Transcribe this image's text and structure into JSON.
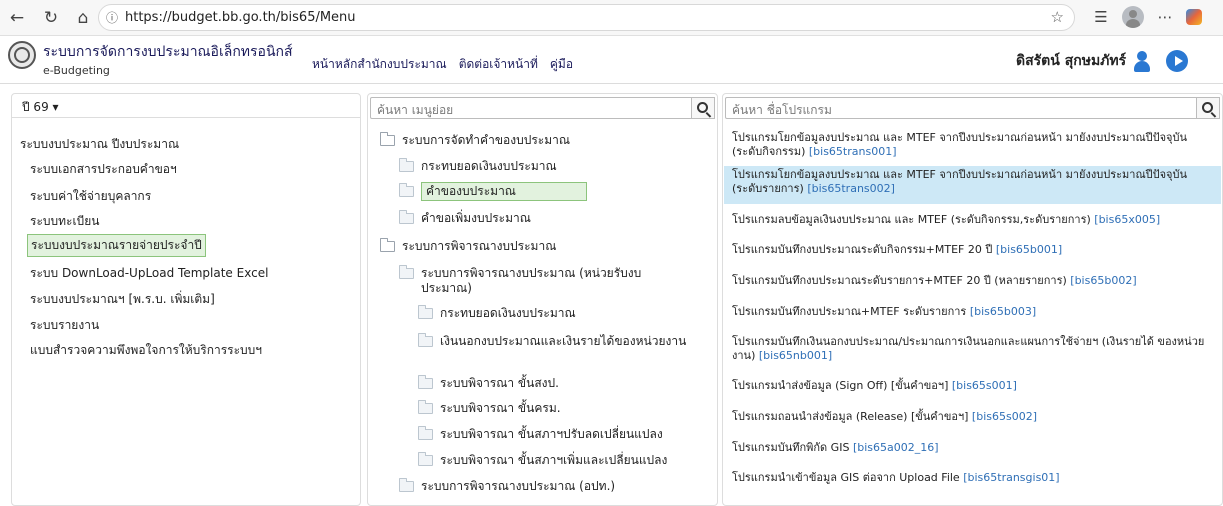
{
  "browser": {
    "url": "https://budget.bb.go.th/bis65/Menu"
  },
  "header": {
    "system_title": "ระบบการจัดการงบประมาณอิเล็กทรอนิกส์",
    "system_subtitle": "e-Budgeting",
    "nav": [
      "หน้าหลักสำนักงบประมาณ",
      "ติดต่อเจ้าหน้าที่",
      "คู่มือ"
    ],
    "user_name": "ดิสรัตน์ สุกษมภัทร์"
  },
  "left_panel": {
    "year_label": "ปี 69 ▾",
    "items": [
      "ระบบงบประมาณ ปีงบประมาณ",
      "ระบบเอกสารประกอบคำขอฯ",
      "ระบบค่าใช้จ่ายบุคลากร",
      "ระบบทะเบียน",
      "ระบบงบประมาณรายจ่ายประจำปี",
      "ระบบ DownLoad-UpLoad Template Excel",
      "ระบบงบประมาณฯ [พ.ร.บ. เพิ่มเติม]",
      "ระบบรายงาน",
      "แบบสำรวจความพึงพอใจการให้บริการระบบฯ"
    ],
    "selected_index": 4
  },
  "middle_panel": {
    "search_placeholder": "ค้นหา เมนูย่อย",
    "items": [
      "ระบบการจัดทำคำของบประมาณ",
      "กระทบยอดเงินงบประมาณ",
      "คำของบประมาณ",
      "คำขอเพิ่มงบประมาณ",
      "ระบบการพิจารณางบประมาณ",
      "ระบบการพิจารณางบประมาณ (หน่วยรับงบประมาณ)",
      "กระทบยอดเงินงบประมาณ",
      "เงินนอกงบประมาณและเงินรายได้ของหน่วยงาน",
      "ระบบพิจารณา ขั้นสงป.",
      "ระบบพิจารณา ขั้นครม.",
      "ระบบพิจารณา ขั้นสภาฯปรับลดเปลี่ยนแปลง",
      "ระบบพิจารณา ขั้นสภาฯเพิ่มและเปลี่ยนแปลง",
      "ระบบการพิจารณางบประมาณ (อปท.)"
    ],
    "selected_index": 2
  },
  "right_panel": {
    "search_placeholder": "ค้นหา ชื่อโปรแกรม",
    "programs": [
      {
        "name": "โปรแกรมโยกข้อมูลงบประมาณ และ MTEF จากปีงบประมาณก่อนหน้า มายังงบประมาณปีปัจจุบัน (ระดับกิจกรรม)",
        "code": "[bis65trans001]"
      },
      {
        "name": "โปรแกรมโยกข้อมูลงบประมาณ และ MTEF จากปีงบประมาณก่อนหน้า มายังงบประมาณปีปัจจุบัน (ระดับรายการ)",
        "code": "[bis65trans002]"
      },
      {
        "name": "โปรแกรมลบข้อมูลเงินงบประมาณ และ MTEF (ระดับกิจกรรม,ระดับรายการ)",
        "code": "[bis65x005]"
      },
      {
        "name": "โปรแกรมบันทึกงบประมาณระดับกิจกรรม+MTEF 20 ปี",
        "code": "[bis65b001]"
      },
      {
        "name": "โปรแกรมบันทึกงบประมาณระดับรายการ+MTEF 20 ปี (หลายรายการ)",
        "code": "[bis65b002]"
      },
      {
        "name": "โปรแกรมบันทึกงบประมาณ+MTEF ระดับรายการ",
        "code": "[bis65b003]"
      },
      {
        "name": "โปรแกรมบันทึกเงินนอกงบประมาณ/ประมาณการเงินนอกและแผนการใช้จ่ายฯ (เงินรายได้ ของหน่วยงาน)",
        "code": "[bis65nb001]"
      },
      {
        "name": "โปรแกรมนำส่งข้อมูล (Sign Off) [ขั้นคำขอฯ]",
        "code": "[bis65s001]"
      },
      {
        "name": "โปรแกรมถอนนำส่งข้อมูล (Release) [ขั้นคำขอฯ]",
        "code": "[bis65s002]"
      },
      {
        "name": "โปรแกรมบันทึกพิกัด GIS",
        "code": "[bis65a002_16]"
      },
      {
        "name": "โปรแกรมนำเข้าข้อมูล GIS ต่อจาก Upload File",
        "code": "[bis65transgis01]"
      }
    ],
    "selected_index": 1
  }
}
